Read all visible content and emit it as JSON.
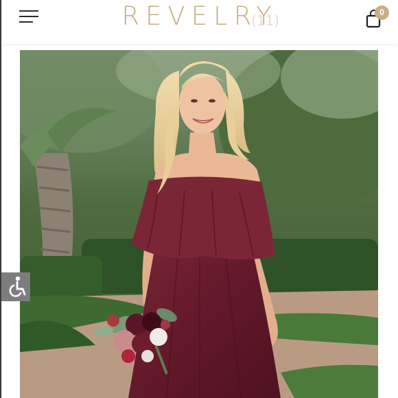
{
  "header": {
    "brand": "REVELRY",
    "ghost_text": "(11)",
    "menu_icon": "hamburger-menu-icon",
    "cart_icon": "shopping-bag-icon",
    "cart_count": "0",
    "brand_color": "#c7ad82",
    "badge_color": "#c9ae84"
  },
  "product": {
    "image_description_icon": "product-photo",
    "dress_color": "#6e1f2e"
  },
  "accessibility": {
    "icon": "wheelchair-icon",
    "bg_color": "#7d7d7d"
  }
}
